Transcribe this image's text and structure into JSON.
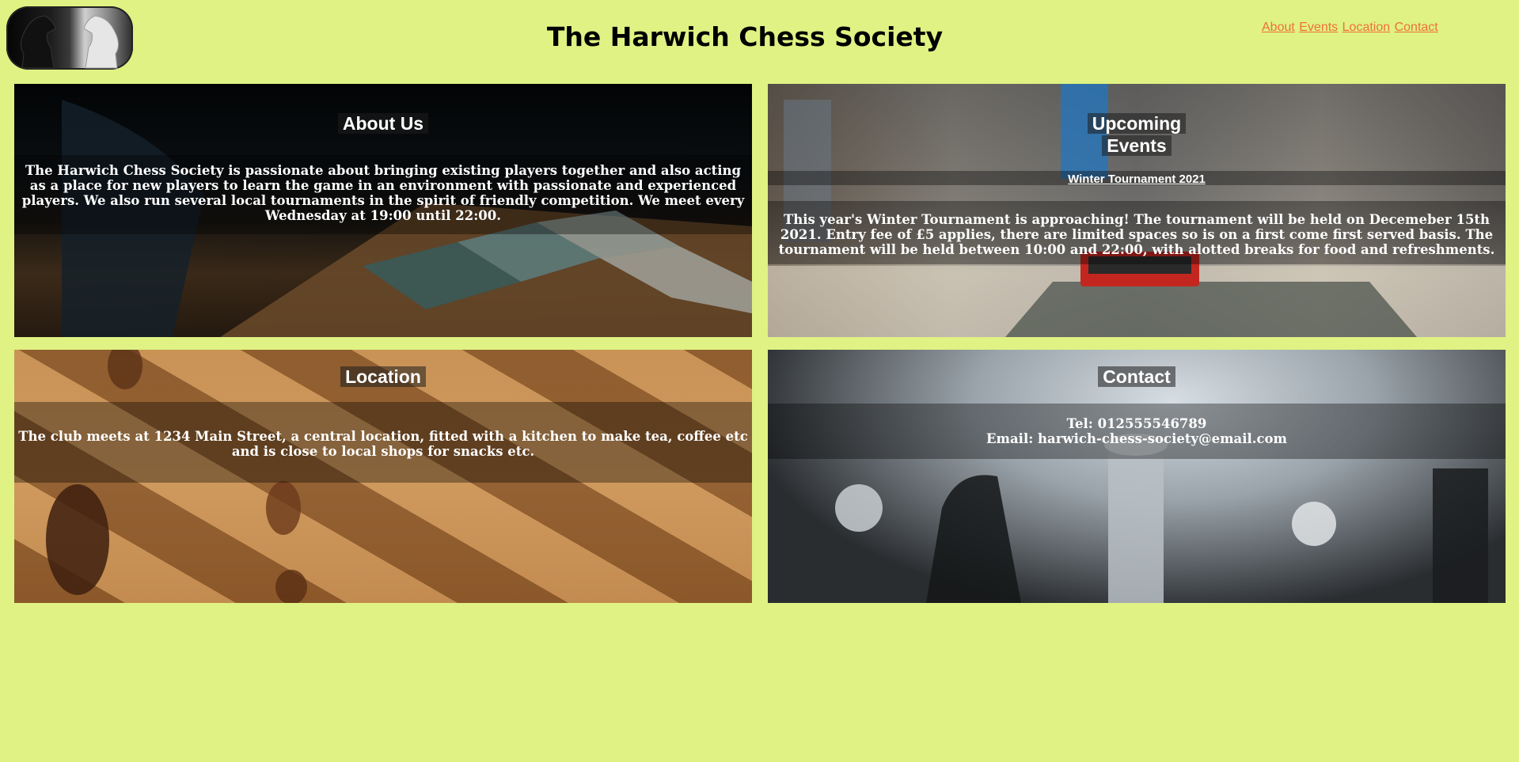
{
  "site": {
    "title": "The Harwich Chess Society"
  },
  "nav": {
    "items": [
      {
        "label": "About"
      },
      {
        "label": "Events"
      },
      {
        "label": "Location"
      },
      {
        "label": "Contact"
      }
    ]
  },
  "cards": {
    "about": {
      "heading": "About Us",
      "text": "The Harwich Chess Society is passionate about bringing existing players together and also acting as a place for new players to learn the game in an environment with passionate and experienced players. We also run several local tournaments in the spirit of friendly competition. We meet every Wednesday at 19:00 until 22:00."
    },
    "events": {
      "heading_line1": "Upcoming",
      "heading_line2": "Events",
      "subheading": "Winter Tournament 2021",
      "text": "This year's Winter Tournament is approaching! The tournament will be held on Decemeber 15th 2021. Entry fee of £5 applies, there are limited spaces so is on a first come first served basis. The tournament will be held between 10:00 and 22:00, with alotted breaks for food and refreshments."
    },
    "location": {
      "heading": "Location",
      "text": "The club meets at 1234 Main Street, a central location, fitted with a kitchen to make tea, coffee etc and is close to local shops for snacks etc."
    },
    "contact": {
      "heading": "Contact",
      "tel": "Tel: 012555546789",
      "email": "Email: harwich-chess-society@email.com"
    }
  }
}
